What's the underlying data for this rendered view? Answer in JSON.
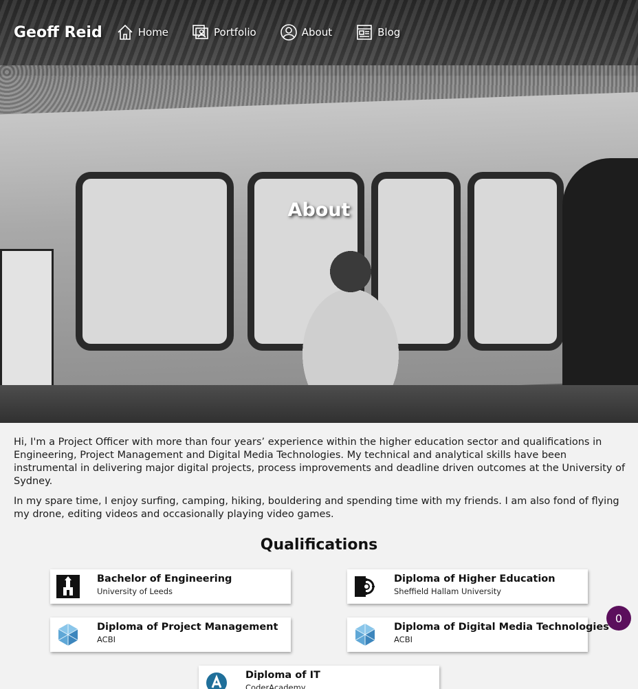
{
  "nav": {
    "brand": "Geoff Reid",
    "items": [
      {
        "label": "Home",
        "icon": "home-icon"
      },
      {
        "label": "Portfolio",
        "icon": "portfolio-icon"
      },
      {
        "label": "About",
        "icon": "user-icon"
      },
      {
        "label": "Blog",
        "icon": "blog-icon"
      }
    ]
  },
  "hero": {
    "title": "About",
    "image": "black-and-white photo of a man sitting in front of a graffiti covered freight wagon"
  },
  "intro": {
    "paragraph1": "Hi, I'm a Project Officer with more than four years’ experience within the higher education sector and qualifications in Engineering, Project Management and Digital Media Technologies. My technical and analytical skills have been instrumental in delivering major digital projects, process improvements and deadline driven outcomes at the University of Sydney.",
    "paragraph2": "In my spare time, I enjoy surfing, camping, hiking, bouldering and spending time with my friends. I am also fond of flying my drone, editing videos and occasionally playing video games."
  },
  "qualifications": {
    "title": "Qualifications",
    "items": [
      {
        "degree": "Bachelor of Engineering",
        "institution": "University of Leeds",
        "logo": "leeds-logo"
      },
      {
        "degree": "Diploma of Higher Education",
        "institution": "Sheffield Hallam University",
        "logo": "sheffield-hallam-logo"
      },
      {
        "degree": "Diploma of Project Management",
        "institution": "ACBI",
        "logo": "acbi-logo"
      },
      {
        "degree": "Diploma of Digital Media Technologies",
        "institution": "ACBI",
        "logo": "acbi-logo"
      },
      {
        "degree": "Diploma of IT",
        "institution": "CoderAcademy",
        "logo": "coderacademy-logo"
      }
    ]
  },
  "badge": {
    "count": "0"
  },
  "colors": {
    "badge": "#5b0f5c",
    "background": "#f2f2f2",
    "card": "#ffffff"
  }
}
